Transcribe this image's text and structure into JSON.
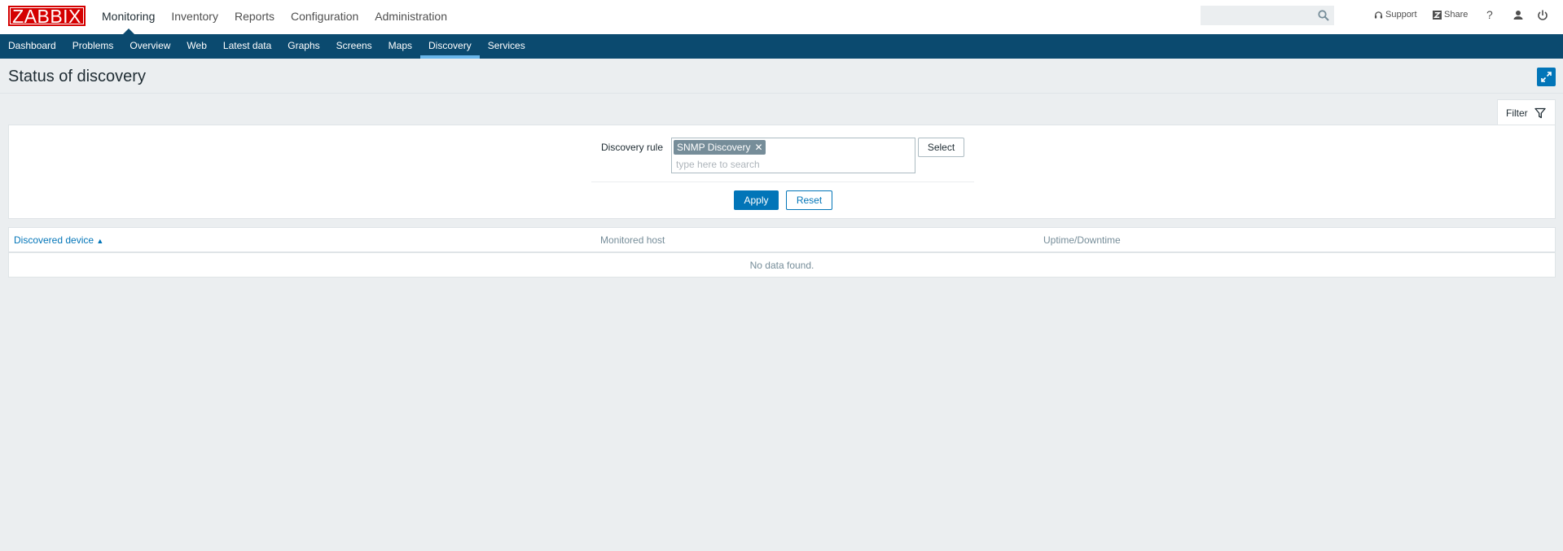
{
  "header": {
    "logo_text": "ZABBIX",
    "main_nav": [
      "Monitoring",
      "Inventory",
      "Reports",
      "Configuration",
      "Administration"
    ],
    "active_main": "Monitoring",
    "search_value": "",
    "support_label": "Support",
    "share_label": "Share",
    "help_label": "?"
  },
  "subnav": {
    "items": [
      "Dashboard",
      "Problems",
      "Overview",
      "Web",
      "Latest data",
      "Graphs",
      "Screens",
      "Maps",
      "Discovery",
      "Services"
    ],
    "active": "Discovery"
  },
  "page": {
    "title": "Status of discovery"
  },
  "filter": {
    "tab_label": "Filter",
    "rule_label": "Discovery rule",
    "selected_rule": "SNMP Discovery",
    "search_placeholder": "type here to search",
    "select_label": "Select",
    "apply_label": "Apply",
    "reset_label": "Reset"
  },
  "table": {
    "columns": [
      "Discovered device",
      "Monitored host",
      "Uptime/Downtime"
    ],
    "sort_indicator": "▲",
    "empty_text": "No data found."
  },
  "colors": {
    "brand_red": "#d40000",
    "nav_blue": "#0b4a6f",
    "accent_blue": "#0275b8",
    "active_tab_underline": "#69b6ea"
  }
}
